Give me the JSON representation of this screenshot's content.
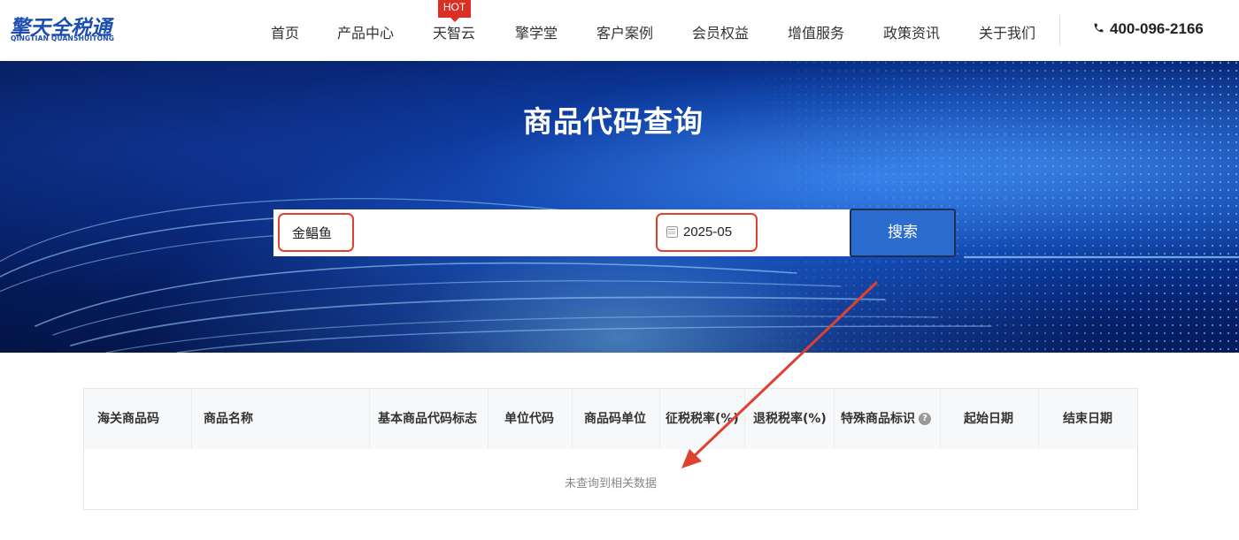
{
  "header": {
    "logo_text": "擎天全税通",
    "logo_sub": "QINGTIAN QUANSHUITONG",
    "nav": [
      {
        "label": "首页"
      },
      {
        "label": "产品中心"
      },
      {
        "label": "天智云"
      },
      {
        "label": "擎学堂"
      },
      {
        "label": "客户案例"
      },
      {
        "label": "会员权益"
      },
      {
        "label": "增值服务"
      },
      {
        "label": "政策资讯"
      },
      {
        "label": "关于我们"
      }
    ],
    "hot_badge": "HOT",
    "phone": "400-096-2166",
    "phone_icon": "phone-icon"
  },
  "banner": {
    "title": "商品代码查询"
  },
  "search": {
    "query_value": "金鲳鱼",
    "date_value": "2025-05",
    "button_label": "搜索"
  },
  "table": {
    "columns": [
      "海关商品码",
      "商品名称",
      "基本商品代码标志",
      "单位代码",
      "商品码单位",
      "征税税率(%)",
      "退税税率(%)",
      "特殊商品标识",
      "起始日期",
      "结束日期"
    ],
    "help_icon_glyph": "?",
    "empty_message": "未查询到相关数据"
  },
  "colors": {
    "brand": "#1d4fb3",
    "hot": "#d93025",
    "highlight": "#e0412f",
    "button": "#2d6ccf"
  }
}
